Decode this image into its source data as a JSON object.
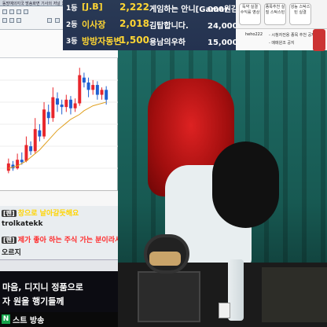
{
  "window": {
    "title": "동방예의지국 방송화면 기사의 저널 1분봉"
  },
  "ranking": [
    {
      "rank": "1등",
      "name": "[J.B]",
      "value": "2,222",
      "unit": "개",
      "gw_rank": "1등",
      "gw_name": "게임하는 안니[Gamer 감BVA]",
      "gw_value": "000원"
    },
    {
      "rank": "2등",
      "name": "이사장",
      "value": "2,018",
      "unit": "개",
      "gw_rank": "2등",
      "gw_name": "김탑합니다.",
      "gw_value": "24,000원"
    },
    {
      "rank": "3등",
      "name": "방방자동변",
      "value": "1,500",
      "unit": "개",
      "gw_rank": "3등",
      "gw_name": "용남의우하",
      "gw_value": "15,000원"
    }
  ],
  "side_panel": {
    "boxes": [
      "독약 실결 수익률 영상",
      "종목추천 실질 스탁스틴",
      "성능 스탁스틴 실결"
    ],
    "profile_name": "heho222",
    "profile_line1": "- 시청자전용 종목 추천 공지",
    "profile_line2": "- 매매원조 공지"
  },
  "chart_data": {
    "type": "candlestick",
    "candles": [
      {
        "o": 12,
        "c": 18,
        "h": 22,
        "l": 10,
        "up": true
      },
      {
        "o": 17,
        "c": 14,
        "h": 20,
        "l": 12,
        "up": false
      },
      {
        "o": 14,
        "c": 21,
        "h": 26,
        "l": 13,
        "up": true
      },
      {
        "o": 21,
        "c": 19,
        "h": 27,
        "l": 17,
        "up": false
      },
      {
        "o": 20,
        "c": 33,
        "h": 40,
        "l": 19,
        "up": true
      },
      {
        "o": 32,
        "c": 28,
        "h": 36,
        "l": 25,
        "up": false
      },
      {
        "o": 28,
        "c": 46,
        "h": 55,
        "l": 26,
        "up": true
      },
      {
        "o": 45,
        "c": 40,
        "h": 50,
        "l": 36,
        "up": false
      },
      {
        "o": 40,
        "c": 62,
        "h": 68,
        "l": 38,
        "up": true
      },
      {
        "o": 60,
        "c": 55,
        "h": 66,
        "l": 50,
        "up": false
      },
      {
        "o": 55,
        "c": 72,
        "h": 80,
        "l": 52,
        "up": true
      },
      {
        "o": 71,
        "c": 66,
        "h": 76,
        "l": 60,
        "up": false
      },
      {
        "o": 66,
        "c": 64,
        "h": 70,
        "l": 58,
        "up": false
      },
      {
        "o": 64,
        "c": 70,
        "h": 74,
        "l": 60,
        "up": true
      },
      {
        "o": 70,
        "c": 63,
        "h": 73,
        "l": 58,
        "up": false
      },
      {
        "o": 63,
        "c": 67,
        "h": 71,
        "l": 60,
        "up": true
      },
      {
        "o": 67,
        "c": 90,
        "h": 96,
        "l": 65,
        "up": true
      },
      {
        "o": 88,
        "c": 84,
        "h": 92,
        "l": 80,
        "up": false
      },
      {
        "o": 84,
        "c": 78,
        "h": 88,
        "l": 72,
        "up": false
      },
      {
        "o": 78,
        "c": 82,
        "h": 86,
        "l": 74,
        "up": true
      },
      {
        "o": 82,
        "c": 74,
        "h": 85,
        "l": 70,
        "up": false
      },
      {
        "o": 74,
        "c": 78,
        "h": 80,
        "l": 70,
        "up": true
      },
      {
        "o": 78,
        "c": 70,
        "h": 81,
        "l": 66,
        "up": false
      }
    ],
    "ma": [
      14,
      15,
      16,
      18,
      20,
      23,
      26,
      29,
      33,
      37,
      41,
      45,
      48,
      51,
      54,
      56,
      58,
      61,
      63,
      65,
      66,
      67,
      68
    ],
    "ylim": [
      0,
      100
    ]
  },
  "chat": [
    {
      "user": "[팬]",
      "text": "창으로 날아갈듯해요",
      "color": "#ffd400"
    },
    {
      "user": "trolkatekk",
      "text": "",
      "color": "#1a1a1a"
    },
    {
      "user": "[팬]",
      "text": "제가 좋아 하는 주식 가는 분이라서",
      "color": "#ff2a2a"
    },
    {
      "user": "",
      "text": "오르지",
      "color": "#1a1a1a"
    }
  ],
  "ad": {
    "line1": "마음, 디지니 정품으로",
    "line2": "자 원을 행기들께"
  },
  "status": {
    "badge": "N",
    "text": "스트 방송"
  },
  "colors": {
    "up": "#e8262c",
    "down": "#1f5fd1",
    "rank_gold": "#ffd633"
  }
}
